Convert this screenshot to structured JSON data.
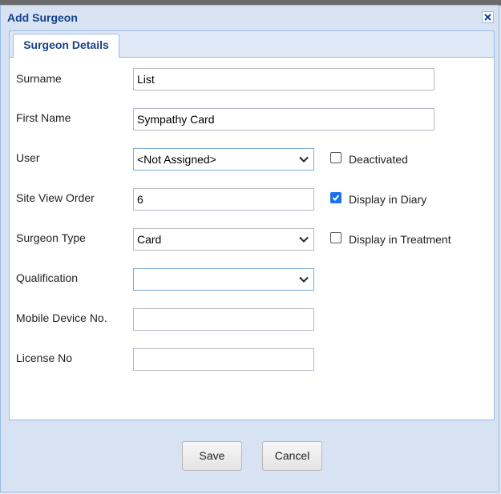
{
  "dialog": {
    "title": "Add Surgeon"
  },
  "tabs": [
    {
      "label": "Surgeon Details"
    }
  ],
  "form": {
    "surname": {
      "label": "Surname",
      "value": "List"
    },
    "first_name": {
      "label": "First Name",
      "value": "Sympathy Card"
    },
    "user": {
      "label": "User",
      "value": "<Not Assigned>"
    },
    "site_view_order": {
      "label": "Site View Order",
      "value": "6"
    },
    "surgeon_type": {
      "label": "Surgeon Type",
      "value": "Card"
    },
    "qualification": {
      "label": "Qualification",
      "value": ""
    },
    "mobile_device_no": {
      "label": "Mobile Device No.",
      "value": ""
    },
    "license_no": {
      "label": "License No",
      "value": ""
    },
    "deactivated": {
      "label": "Deactivated",
      "checked": false
    },
    "display_in_diary": {
      "label": "Display in Diary",
      "checked": true
    },
    "display_in_treatment": {
      "label": "Display in Treatment",
      "checked": false
    }
  },
  "buttons": {
    "save": "Save",
    "cancel": "Cancel"
  },
  "colors": {
    "title": "#15428b",
    "border": "#99bbe8",
    "check": "#1a73e8"
  },
  "icons": {
    "close": "close-icon",
    "select": "chevron-down-icon",
    "check": "checkmark-icon"
  }
}
